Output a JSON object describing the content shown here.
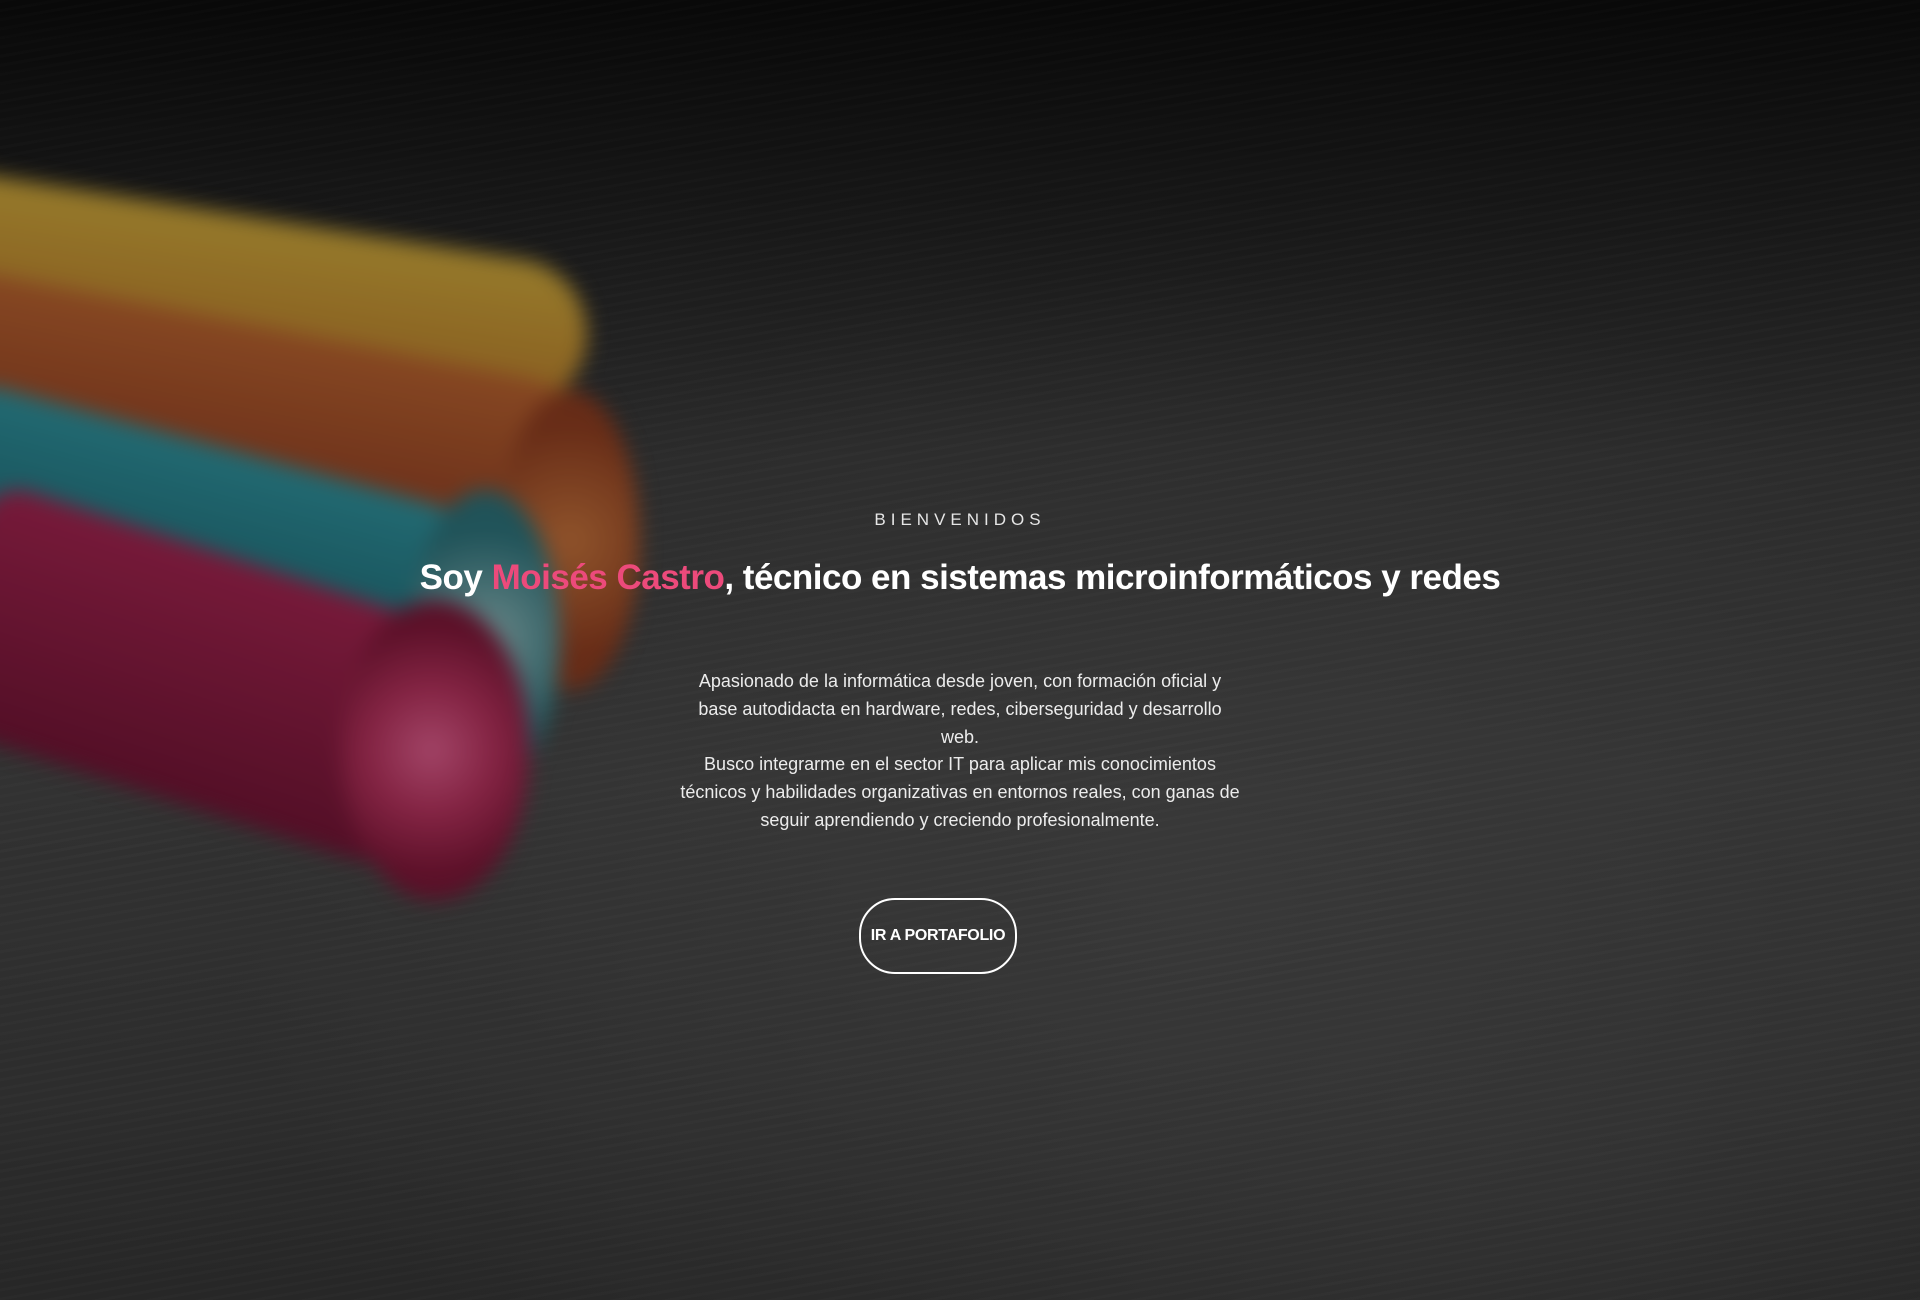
{
  "hero": {
    "eyebrow": "BIENVENIDOS",
    "headline_prefix": "Soy ",
    "headline_name": "Moisés Castro",
    "headline_suffix": ", técnico en sistemas microinformáticos y redes",
    "paragraph_1": "Apasionado de la informática desde joven, con formación oficial y base autodidacta en hardware, redes, ciberseguridad y desarrollo web.",
    "paragraph_2": "Busco integrarme en el sector IT para aplicar mis conocimientos técnicos y habilidades organizativas en entornos reales, con ganas de seguir aprendiendo y creciendo profesionalmente.",
    "cta_label": "IR A PORTAFOLIO"
  },
  "colors": {
    "accent": "#ec4a7b",
    "text": "#ffffff",
    "background": "#3a3a3a"
  }
}
